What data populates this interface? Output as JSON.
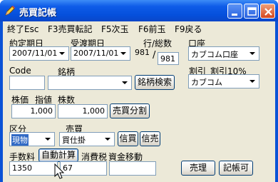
{
  "window": {
    "title": "売買記帳"
  },
  "menu": [
    {
      "label": "終了Esc"
    },
    {
      "label": "F3売買転記"
    },
    {
      "label": "F5次玉"
    },
    {
      "label": "F6前玉"
    },
    {
      "label": "F9戻る"
    }
  ],
  "form": {
    "yakujo_label": "約定期日",
    "yakujo_value": "2007/11/01",
    "ukewatashi_label": "受渡期日",
    "ukewatashi_value": "2007/11/01",
    "row_label": "行/総数",
    "row_value": "981",
    "row_sep": "/",
    "total_value": "981",
    "account_label": "口座",
    "account_value": "カブコム口座",
    "code_label": "Code",
    "code_value": "",
    "meigara_label": "銘柄",
    "meigara_value": "",
    "search_button": "銘柄検索",
    "waribiki_label": "割引",
    "waribiki_rate_label": "割引10%",
    "broker_value": "カブコム",
    "price_label": "株価",
    "sashine_label": "指値",
    "price_value": "1,000",
    "shares_label": "株数",
    "shares_value": "1,000",
    "split_button": "売買分割",
    "kubun_label": "区分",
    "kubun_value": "現物",
    "baibai_label": "売買",
    "baibai_value": "買仕掛",
    "credit_buy_button": "信買",
    "credit_sell_button": "信売",
    "fee_label": "手数料",
    "auto_calc_button": "自動計算",
    "tax_label": "消費税",
    "fund_label": "資金移動",
    "fee_value": "1350",
    "tax_value": "67",
    "fund_value": "",
    "sell_button": "売理",
    "record_button": "記帳可"
  }
}
